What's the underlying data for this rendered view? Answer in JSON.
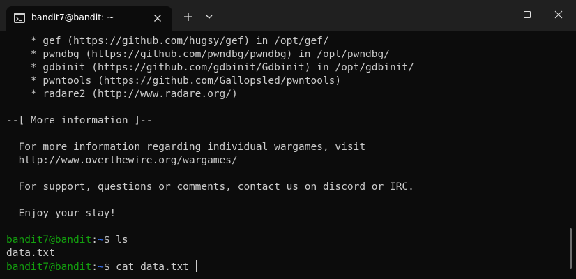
{
  "window": {
    "tab_title": "bandit7@bandit: ~",
    "icons": {
      "terminal": "terminal-icon",
      "tab_close": "close-icon",
      "new_tab": "plus-icon",
      "dropdown": "chevron-down-icon",
      "minimize": "minimize-icon",
      "maximize": "maximize-icon",
      "close": "close-icon"
    }
  },
  "colors": {
    "background": "#0c0c0c",
    "titlebar": "#202020",
    "text": "#cccccc",
    "prompt_user": "#13a10e",
    "prompt_path": "#3b78ff"
  },
  "terminal": {
    "tools": [
      "    * gef (https://github.com/hugsy/gef) in /opt/gef/",
      "    * pwndbg (https://github.com/pwndbg/pwndbg) in /opt/pwndbg/",
      "    * gdbinit (https://github.com/gdbinit/Gdbinit) in /opt/gdbinit/",
      "    * pwntools (https://github.com/Gallopsled/pwntools)",
      "    * radare2 (http://www.radare.org/)"
    ],
    "section_header": "--[ More information ]--",
    "info_line_1": "  For more information regarding individual wargames, visit",
    "info_line_2": "  http://www.overthewire.org/wargames/",
    "support_line": "  For support, questions or comments, contact us on discord or IRC.",
    "enjoy_line": "  Enjoy your stay!",
    "prompt_user": "bandit7@bandit",
    "prompt_colon": ":",
    "prompt_path": "~",
    "prompt_symbol": "$ ",
    "command_1": "ls",
    "output_1": "data.txt",
    "command_2": "cat data.txt "
  }
}
